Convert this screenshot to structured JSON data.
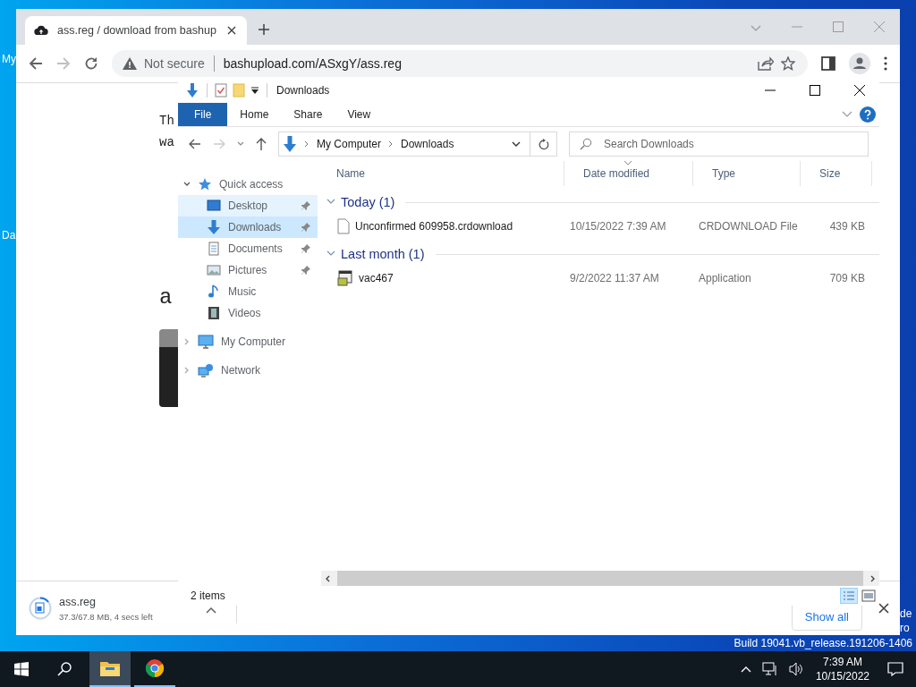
{
  "desktop": {
    "icon_labels": [
      "My",
      "Da"
    ],
    "edge_texts": [
      "de",
      "ro"
    ],
    "build_text": "Build 19041.vb_release.191206-1406"
  },
  "browser": {
    "tab": {
      "title": "ass.reg / download from bashup"
    },
    "address": {
      "security": "Not secure",
      "url": "bashupload.com/ASxgY/ass.reg"
    },
    "page_texts": [
      {
        "text": "Th",
        "kind": "line"
      },
      {
        "text": "wa",
        "kind": "line"
      },
      {
        "text": "a",
        "kind": "large"
      }
    ],
    "download": {
      "file": "ass.reg",
      "progress": "37.3/67.8 MB, 4 secs left",
      "show_all": "Show all"
    }
  },
  "explorer": {
    "title": "Downloads",
    "ribbon_tabs": [
      {
        "label": "File",
        "selected": true
      },
      {
        "label": "Home",
        "selected": false
      },
      {
        "label": "Share",
        "selected": false
      },
      {
        "label": "View",
        "selected": false
      }
    ],
    "breadcrumb": [
      "My Computer",
      "Downloads"
    ],
    "search": {
      "placeholder": "Search Downloads"
    },
    "nav": [
      {
        "label": "Quick access",
        "kind": "star",
        "expanded": true,
        "children": [
          {
            "label": "Desktop",
            "kind": "desktop",
            "pinned": true,
            "selected": false,
            "hovered": true
          },
          {
            "label": "Downloads",
            "kind": "downloads",
            "pinned": true,
            "selected": true,
            "hovered": false
          },
          {
            "label": "Documents",
            "kind": "documents",
            "pinned": true,
            "selected": false,
            "hovered": false
          },
          {
            "label": "Pictures",
            "kind": "pictures",
            "pinned": true,
            "selected": false,
            "hovered": false
          },
          {
            "label": "Music",
            "kind": "music",
            "pinned": false,
            "selected": false,
            "hovered": false
          },
          {
            "label": "Videos",
            "kind": "videos",
            "pinned": false,
            "selected": false,
            "hovered": false
          }
        ]
      },
      {
        "label": "My Computer",
        "kind": "computer",
        "expanded": false
      },
      {
        "label": "Network",
        "kind": "network",
        "expanded": false
      }
    ],
    "columns": [
      "Name",
      "Date modified",
      "Type",
      "Size"
    ],
    "groups": [
      {
        "label": "Today (1)",
        "expanded": true,
        "files": [
          {
            "name": "Unconfirmed 609958.crdownload",
            "date": "10/15/2022 7:39 AM",
            "type": "CRDOWNLOAD File",
            "size": "439 KB",
            "kind": "document"
          }
        ]
      },
      {
        "label": "Last month (1)",
        "expanded": true,
        "files": [
          {
            "name": "vac467",
            "date": "9/2/2022 11:37 AM",
            "type": "Application",
            "size": "709 KB",
            "kind": "application"
          }
        ]
      }
    ],
    "status": "2 items"
  },
  "taskbar": {
    "apps": [
      {
        "kind": "explorer",
        "selected": true
      },
      {
        "kind": "chrome",
        "selected": false
      }
    ],
    "time": "7:39 AM",
    "date": "10/15/2022"
  }
}
